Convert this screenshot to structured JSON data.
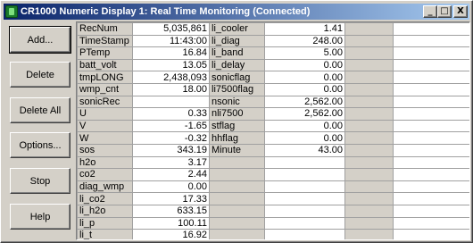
{
  "window": {
    "title": "CR1000 Numeric Display 1: Real Time Monitoring (Connected)",
    "minimize": "_",
    "maximize": "□",
    "close": "X"
  },
  "buttons": {
    "add": "Add...",
    "delete": "Delete",
    "delete_all": "Delete All",
    "options": "Options...",
    "stop": "Stop",
    "help": "Help"
  },
  "grid": {
    "col1": [
      {
        "label": "RecNum",
        "value": "5,035,861"
      },
      {
        "label": "TimeStamp",
        "value": "11:43:00"
      },
      {
        "label": "PTemp",
        "value": "16.84"
      },
      {
        "label": "batt_volt",
        "value": "13.05"
      },
      {
        "label": "tmpLONG",
        "value": "2,438,093"
      },
      {
        "label": "wmp_cnt",
        "value": "18.00"
      },
      {
        "label": "sonicRec",
        "value": ""
      },
      {
        "label": "U",
        "value": "0.33"
      },
      {
        "label": "V",
        "value": "-1.65"
      },
      {
        "label": "W",
        "value": "-0.32"
      },
      {
        "label": "sos",
        "value": "343.19"
      },
      {
        "label": "h2o",
        "value": "3.17"
      },
      {
        "label": "co2",
        "value": "2.44"
      },
      {
        "label": "diag_wmp",
        "value": "0.00"
      },
      {
        "label": "li_co2",
        "value": "17.33"
      },
      {
        "label": "li_h2o",
        "value": "633.15"
      },
      {
        "label": "li_p",
        "value": "100.11"
      },
      {
        "label": "li_t",
        "value": "16.92"
      }
    ],
    "col2": [
      {
        "label": "li_cooler",
        "value": "1.41"
      },
      {
        "label": "li_diag",
        "value": "248.00"
      },
      {
        "label": "li_band",
        "value": "5.00"
      },
      {
        "label": "li_delay",
        "value": "0.00"
      },
      {
        "label": "sonicflag",
        "value": "0.00"
      },
      {
        "label": "li7500flag",
        "value": "0.00"
      },
      {
        "label": "nsonic",
        "value": "2,562.00"
      },
      {
        "label": "nli7500",
        "value": "2,562.00"
      },
      {
        "label": "stflag",
        "value": "0.00"
      },
      {
        "label": "hhflag",
        "value": "0.00"
      },
      {
        "label": "Minute",
        "value": "43.00"
      }
    ]
  }
}
